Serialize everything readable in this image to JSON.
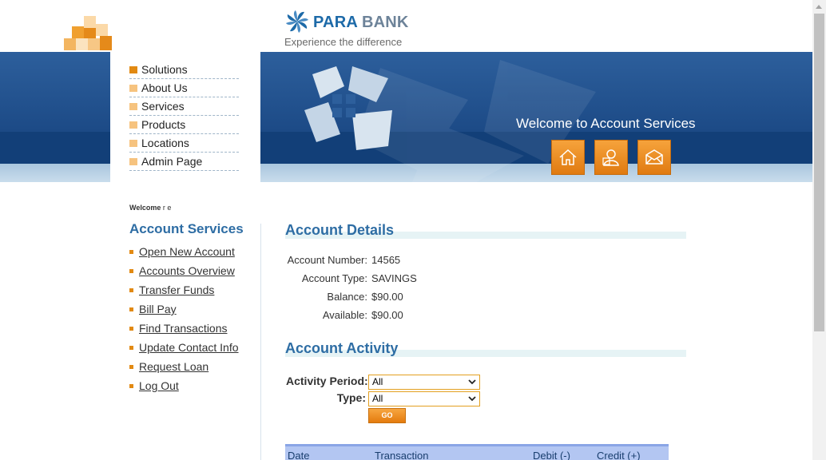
{
  "brand": {
    "name_bold": "PARA",
    "name_light": " BANK",
    "tagline": "Experience the difference"
  },
  "top_menu": [
    {
      "label": "Solutions"
    },
    {
      "label": "About Us"
    },
    {
      "label": "Services"
    },
    {
      "label": "Products"
    },
    {
      "label": "Locations"
    },
    {
      "label": "Admin Page"
    }
  ],
  "banner": {
    "welcome": "Welcome to Account Services",
    "buttons": [
      "home-icon",
      "contact-icon",
      "email-icon"
    ]
  },
  "sidebar": {
    "welcome_prefix": "Welcome",
    "user": " r e",
    "title": "Account Services",
    "links": [
      "Open New Account",
      "Accounts Overview",
      "Transfer Funds",
      "Bill Pay",
      "Find Transactions",
      "Update Contact Info",
      "Request Loan",
      "Log Out"
    ]
  },
  "account_details": {
    "title": "Account Details",
    "rows": [
      {
        "label": "Account Number:",
        "value": "14565"
      },
      {
        "label": "Account Type:",
        "value": "SAVINGS"
      },
      {
        "label": "Balance:",
        "value": "$90.00"
      },
      {
        "label": "Available:",
        "value": "$90.00"
      }
    ]
  },
  "account_activity": {
    "title": "Account Activity",
    "period_label": "Activity Period:",
    "period_value": "All",
    "type_label": "Type:",
    "type_value": "All",
    "go_label": "GO"
  },
  "table": {
    "headers": [
      "Date",
      "Transaction",
      "Debit (-)",
      "Credit (+)"
    ]
  },
  "colors": {
    "accent_orange": "#e28a13",
    "title_blue": "#2e6da4",
    "banner_blue": "#1b4f8a"
  }
}
